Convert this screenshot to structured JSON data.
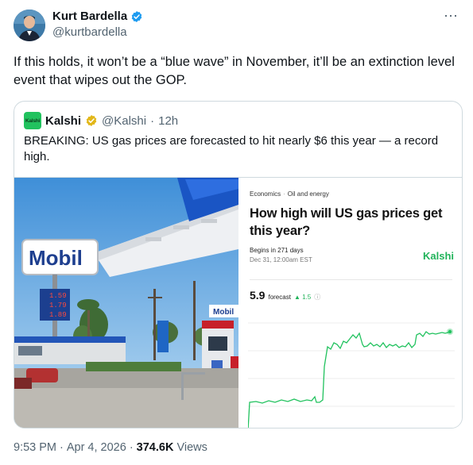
{
  "author": {
    "name": "Kurt Bardella",
    "handle": "@kurtbardella",
    "verified_color": "#1d9bf0"
  },
  "more_icon": "⋯",
  "tweet_text": "If this holds, it won’t be a “blue wave” in November, it’ll be an extinction level event that wipes out the GOP.",
  "quote": {
    "logo_text": "Kalshi",
    "name": "Kalshi",
    "handle": "@Kalshi",
    "separator": "·",
    "time": "12h",
    "verified_color": "#e2b719",
    "text": "BREAKING: US gas prices are forecasted to hit nearly $6 this year — a record high.",
    "photo": {
      "sign_text": "Mobil",
      "price_1": "1.59",
      "price_2": "1.79",
      "price_3": "1.89",
      "canopy_text": "Mobil"
    },
    "card": {
      "crumb_1": "Economics",
      "crumb_sep": "·",
      "crumb_2": "Oil and energy",
      "title": "How high will US gas prices get this year?",
      "begins": "Begins in 271 days",
      "date": "Dec 31, 12:00am EST",
      "brand": "Kalshi",
      "brand_color": "#21b35a",
      "forecast_value": "5.9",
      "forecast_label": "forecast",
      "forecast_delta": "▲ 1.5",
      "info_icon": "ⓘ"
    }
  },
  "footer": {
    "time": "9:53 PM",
    "dot1": "·",
    "date": "Apr 4, 2026",
    "dot2": "·",
    "views_count": "374.6K",
    "views_label": "Views"
  }
}
